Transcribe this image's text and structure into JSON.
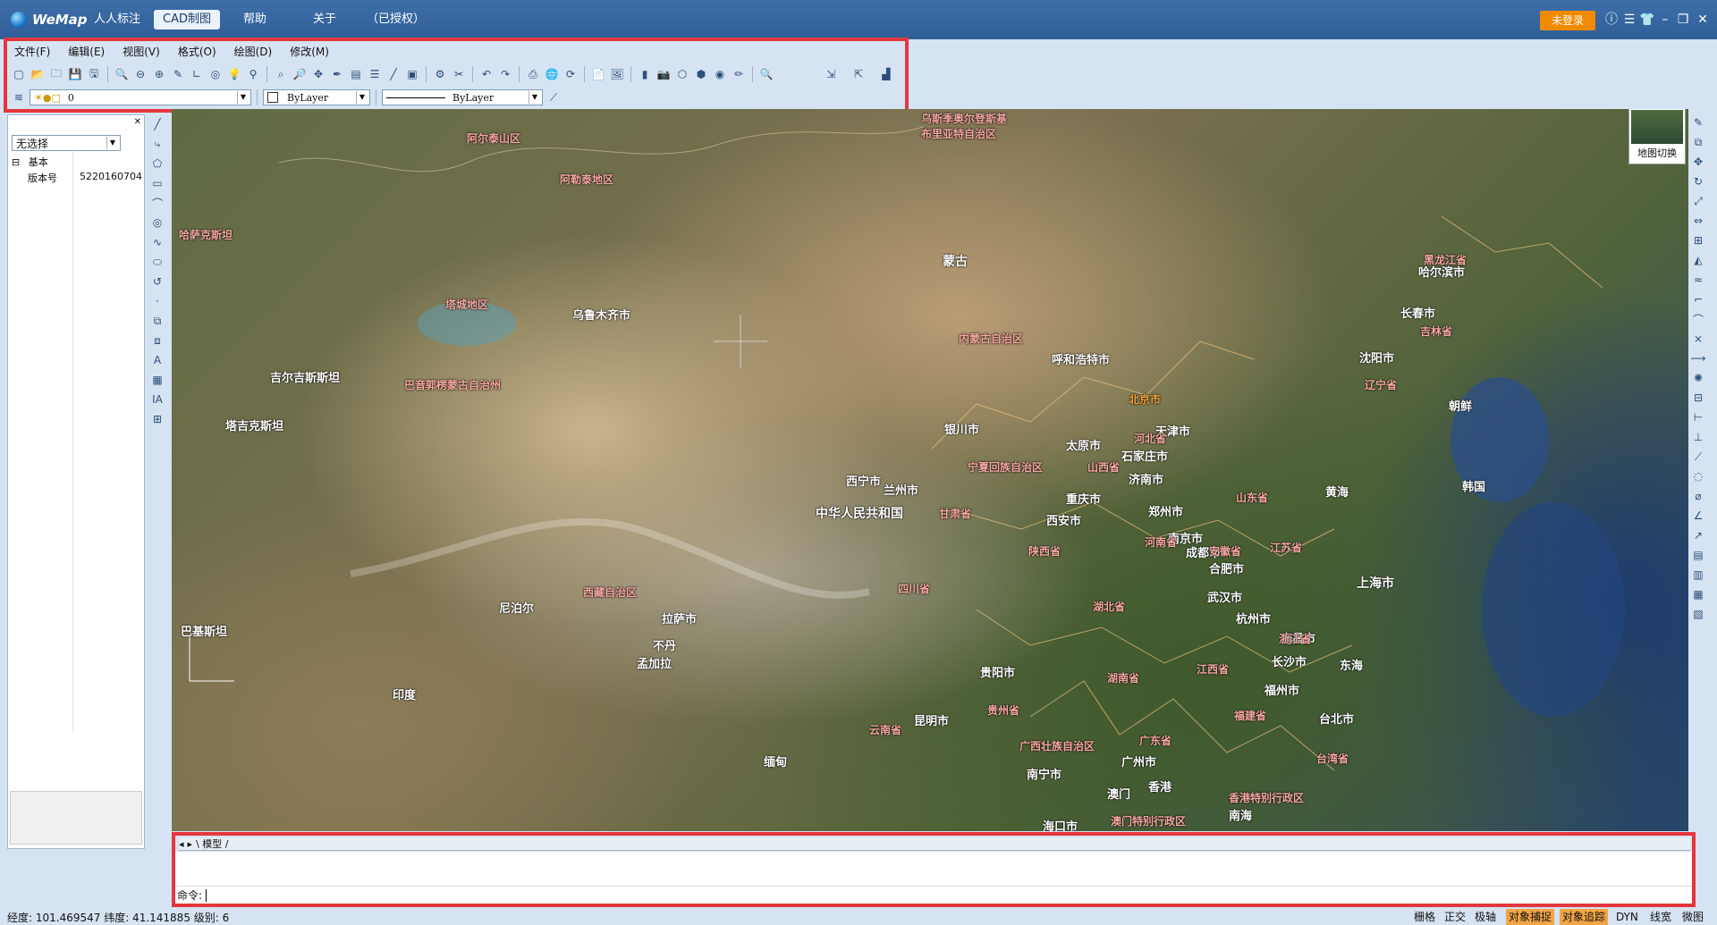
{
  "app": {
    "name": "WeMap"
  },
  "nav": {
    "tabs": [
      {
        "label": "人人标注",
        "active": false
      },
      {
        "label": "CAD制图",
        "active": true
      },
      {
        "label": "帮助",
        "active": false
      },
      {
        "label": "关于",
        "active": false
      },
      {
        "label": "（已授权）",
        "active": false
      }
    ],
    "login": "未登录"
  },
  "menu": {
    "items": [
      "文件(F)",
      "编辑(E)",
      "视图(V)",
      "格式(O)",
      "绘图(D)",
      "修改(M)"
    ]
  },
  "layer_bar": {
    "layer_value": "0",
    "color_value": "ByLayer",
    "linetype_value": "ByLayer"
  },
  "left_panel": {
    "select_value": "无选择",
    "group": "基本",
    "property_name": "版本号",
    "property_value": "5220160704"
  },
  "map": {
    "switch_label": "地图切换",
    "labels": [
      {
        "text": "乌斯季奥尔登斯基\n布里亚特自治区",
        "cls": "pink"
      },
      {
        "text": "哈萨克斯坦",
        "cls": "pink"
      }
    ],
    "countries": [
      "蒙古",
      "中华人民共和国",
      "吉尔吉斯斯坦",
      "塔吉克斯坦",
      "尼泊尔",
      "不丹",
      "印度",
      "孟加拉",
      "缅甸",
      "朝鲜",
      "韩国",
      "巴基斯坦"
    ],
    "cities": [
      "乌鲁木齐市",
      "拉萨市",
      "西宁市",
      "兰州市",
      "银川市",
      "呼和浩特市",
      "北京市",
      "天津市",
      "石家庄市",
      "太原市",
      "济南市",
      "郑州市",
      "西安市",
      "成都市",
      "重庆市",
      "武汉市",
      "合肥市",
      "南京市",
      "上海市",
      "杭州市",
      "长沙市",
      "南昌市",
      "福州市",
      "贵阳市",
      "昆明市",
      "南宁市",
      "广州市",
      "香港",
      "澳门",
      "海口市",
      "台北市",
      "哈尔滨市",
      "长春市",
      "沈阳市"
    ],
    "regions": [
      "阿尔泰山区",
      "阿勒泰地区",
      "塔城地区",
      "巴音郭楞蒙古自治州",
      "西藏自治区",
      "四川省",
      "内蒙古自治区",
      "宁夏回族自治区",
      "甘肃省",
      "陕西省",
      "河南省",
      "湖北省",
      "湖南省",
      "广东省",
      "广西壮族自治区",
      "云南省",
      "贵州省",
      "江西省",
      "浙江省",
      "福建省",
      "江苏省",
      "安徽省",
      "山东省",
      "河北省",
      "山西省",
      "辽宁省",
      "吉林省",
      "黑龙江省",
      "香港特别行政区",
      "澳门特别行政区",
      "台湾省",
      "东海",
      "黄海",
      "南海"
    ]
  },
  "command": {
    "tab_label": "模型",
    "prompt": "命令:"
  },
  "status": {
    "coords": "经度: 101.469547 纬度: 41.141885 级别: 6",
    "buttons": [
      {
        "label": "栅格",
        "on": false
      },
      {
        "label": "正交",
        "on": false
      },
      {
        "label": "极轴",
        "on": false
      },
      {
        "label": "对象捕捉",
        "on": true
      },
      {
        "label": "对象追踪",
        "on": true
      },
      {
        "label": "DYN",
        "on": false
      },
      {
        "label": "线宽",
        "on": false
      },
      {
        "label": "微图",
        "on": false
      }
    ]
  },
  "colors": {
    "title_bg": "#2f5e98",
    "login_bg": "#f08a00",
    "frame_red": "#e5363d",
    "status_on": "#f1a546"
  }
}
